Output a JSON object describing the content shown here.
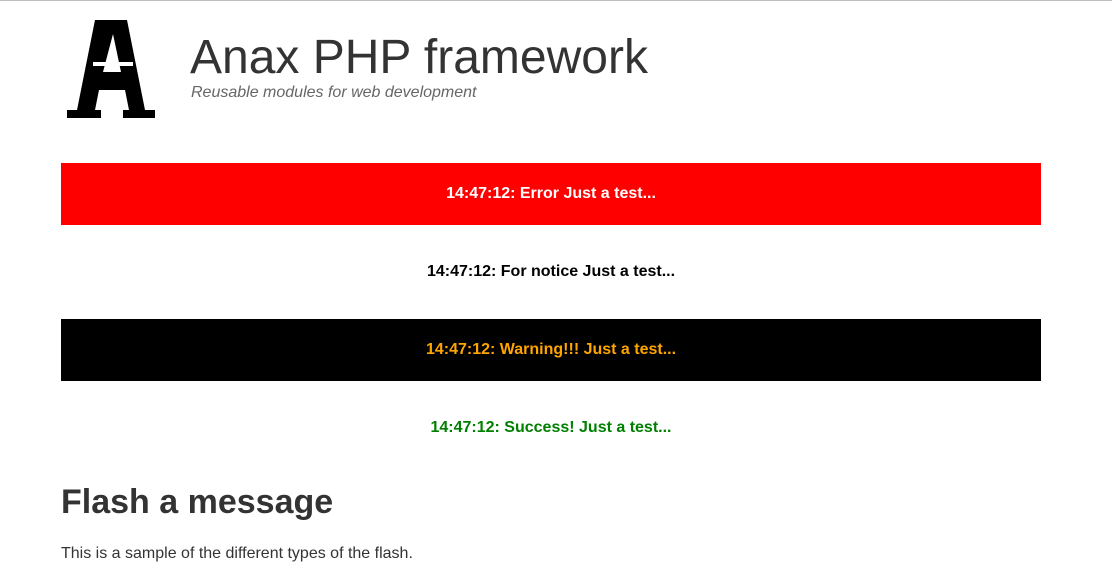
{
  "header": {
    "title": "Anax PHP framework",
    "slogan": "Reusable modules for web development",
    "logo_icon": "anax-logo-icon"
  },
  "flash_messages": [
    {
      "type": "error",
      "text": "14:47:12: Error Just a test...",
      "background": "#ff0000",
      "color": "#ffffff"
    },
    {
      "type": "notice",
      "text": "14:47:12: For notice Just a test...",
      "background": "#ffffff",
      "color": "#000000"
    },
    {
      "type": "warning",
      "text": "14:47:12: Warning!!! Just a test...",
      "background": "#000000",
      "color": "#ffa500"
    },
    {
      "type": "success",
      "text": "14:47:12: Success! Just a test...",
      "background": "#ffffff",
      "color": "#008000"
    }
  ],
  "main": {
    "heading": "Flash a message",
    "text": "This is a sample of the different types of the flash."
  }
}
